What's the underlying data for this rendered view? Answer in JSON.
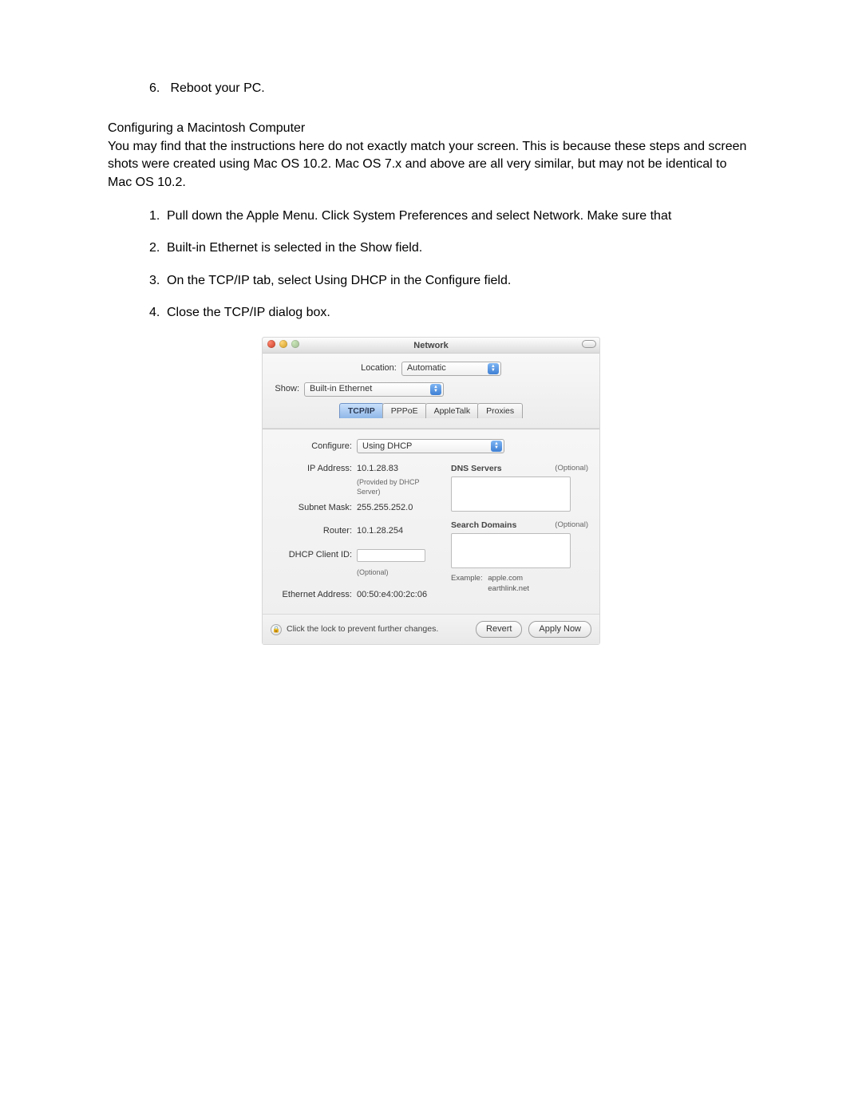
{
  "doc": {
    "step6_num": "6.",
    "step6_text": "Reboot your PC.",
    "heading": "Configuring a Macintosh Computer",
    "intro": "You may find that the instructions here do not exactly match your screen. This is because these steps and screen shots were created using Mac OS 10.2. Mac OS 7.x and above are all very similar, but may not be identical to Mac OS 10.2.",
    "items": [
      {
        "num": "1.",
        "text": "Pull down the Apple Menu. Click System Preferences and select Network. Make sure that"
      },
      {
        "num": "2.",
        "text": "Built-in Ethernet is selected in the Show field."
      },
      {
        "num": "3.",
        "text": "On the TCP/IP tab, select Using DHCP in the Configure field."
      },
      {
        "num": "4.",
        "text": "Close the TCP/IP dialog box."
      }
    ]
  },
  "win": {
    "title": "Network",
    "location_label": "Location:",
    "location_value": "Automatic",
    "show_label": "Show:",
    "show_value": "Built-in Ethernet",
    "tabs": [
      "TCP/IP",
      "PPPoE",
      "AppleTalk",
      "Proxies"
    ],
    "configure_label": "Configure:",
    "configure_value": "Using DHCP",
    "ip_label": "IP Address:",
    "ip_value": "10.1.28.83",
    "ip_note": "(Provided by DHCP Server)",
    "subnet_label": "Subnet Mask:",
    "subnet_value": "255.255.252.0",
    "router_label": "Router:",
    "router_value": "10.1.28.254",
    "dhcp_label": "DHCP Client ID:",
    "dhcp_note": "(Optional)",
    "eth_label": "Ethernet Address:",
    "eth_value": "00:50:e4:00:2c:06",
    "dns_label": "DNS Servers",
    "dns_opt": "(Optional)",
    "search_label": "Search Domains",
    "search_opt": "(Optional)",
    "example_label": "Example:",
    "example_1": "apple.com",
    "example_2": "earthlink.net",
    "lock_text": "Click the lock to prevent further changes.",
    "revert": "Revert",
    "apply": "Apply Now"
  }
}
